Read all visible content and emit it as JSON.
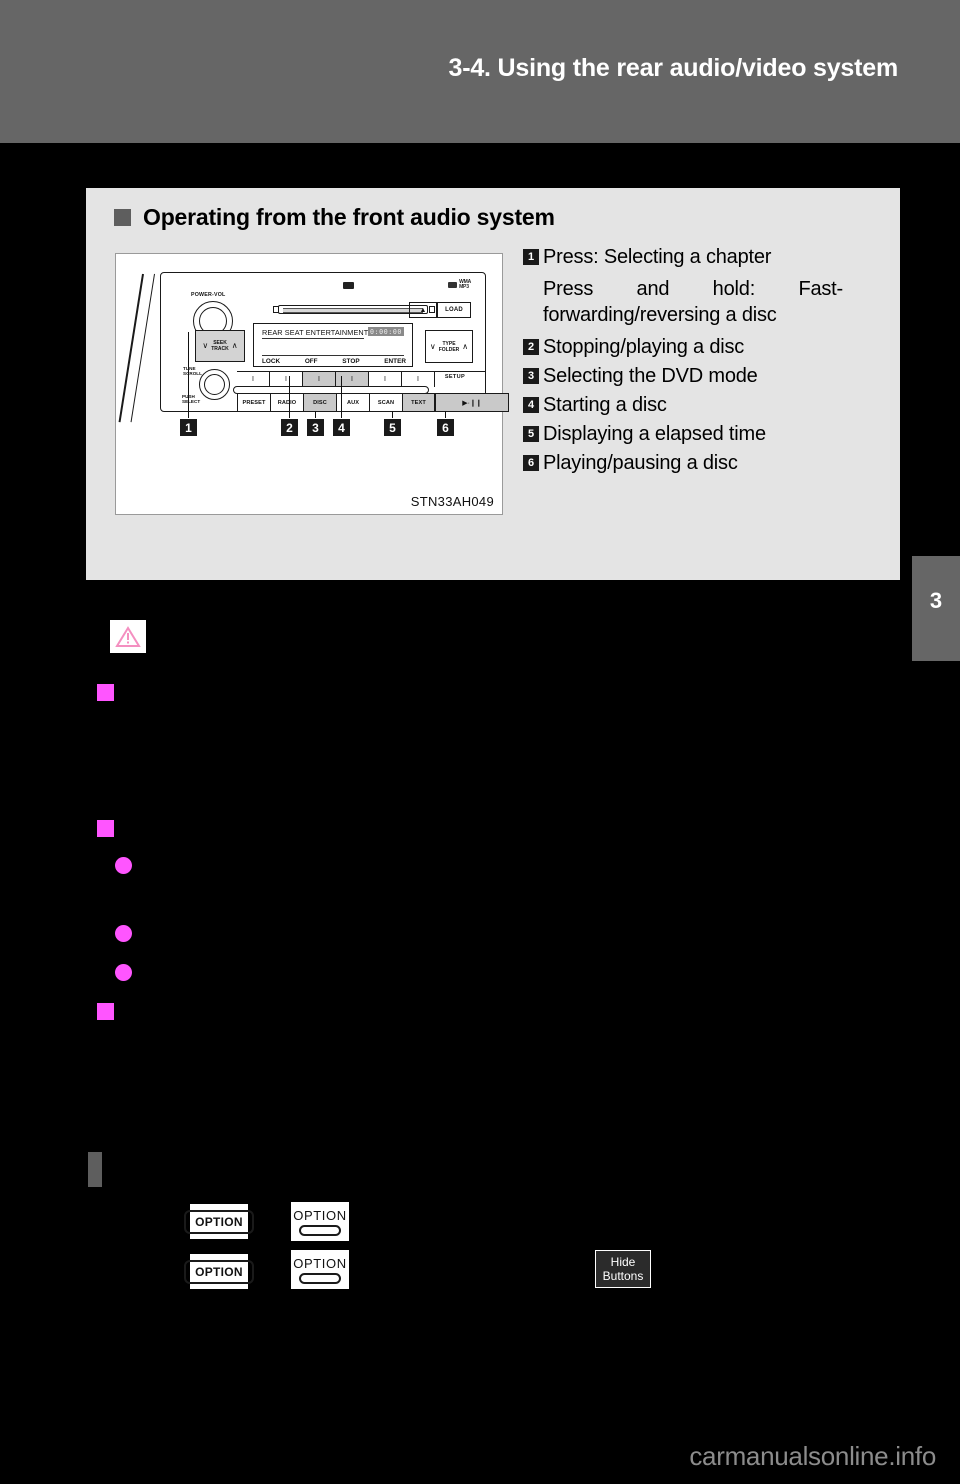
{
  "header": {
    "title": "3-4. Using the rear audio/video system"
  },
  "page_tab": {
    "number": "3"
  },
  "callout": {
    "heading": "Operating from the front audio system",
    "figure_caption": "STN33AH049"
  },
  "radio": {
    "power_vol_label": "POWER-VOL",
    "tune_scroll_label_line1": "TUNE",
    "tune_scroll_label_line2": "SCROLL",
    "push_select_line1": "PUSH",
    "push_select_line2": "SELECT",
    "mp3_logo_line1": "WMA",
    "mp3_logo_line2": "MP3",
    "eject_label": "▲",
    "load_label": "LOAD",
    "seek_label_line1": "SEEK",
    "seek_label_line2": "TRACK",
    "type_folder_line1": "TYPE",
    "type_folder_line2": "FOLDER",
    "chevron_down": "∨",
    "chevron_up": "∧",
    "lcd_title": "REAR SEAT ENTERTAINMENT",
    "lcd_digits": "0:00:00",
    "lcd_softkeys": [
      "LOCK",
      "OFF",
      "STOP",
      "ENTER"
    ],
    "setup_label": "SETUP",
    "tick_marks": [
      "I",
      "I",
      "I",
      "I",
      "I",
      "I"
    ],
    "function_buttons": [
      "PRESET",
      "RADIO",
      "DISC",
      "AUX",
      "SCAN",
      "TEXT"
    ],
    "play_pause_label": "▶·❙❙",
    "callout_numbers": [
      "1",
      "2",
      "3",
      "4",
      "5",
      "6"
    ]
  },
  "explanations": [
    {
      "number": "1",
      "text": "Press: Selecting a chapter",
      "subtext": "Press and hold: Fast-forwarding/reversing a disc"
    },
    {
      "number": "2",
      "text": "Stopping/playing a disc",
      "subtext": ""
    },
    {
      "number": "3",
      "text": "Selecting the DVD mode",
      "subtext": ""
    },
    {
      "number": "4",
      "text": "Starting a disc",
      "subtext": ""
    },
    {
      "number": "5",
      "text": "Displaying a elapsed time",
      "subtext": ""
    },
    {
      "number": "6",
      "text": "Playing/pausing a disc",
      "subtext": ""
    }
  ],
  "option_buttons": {
    "pill_label": "OPTION",
    "stack_label": "OPTION"
  },
  "hide_buttons": {
    "line1": "Hide",
    "line2": "Buttons"
  },
  "footer": {
    "watermark": "carmanualsonline.info"
  },
  "colors": {
    "header_band": "#666666",
    "callout_background": "#e4e4e4",
    "bullet_magenta": "#ff55ff",
    "warning_pink": "#f48fc0",
    "page_background": "#000000"
  }
}
